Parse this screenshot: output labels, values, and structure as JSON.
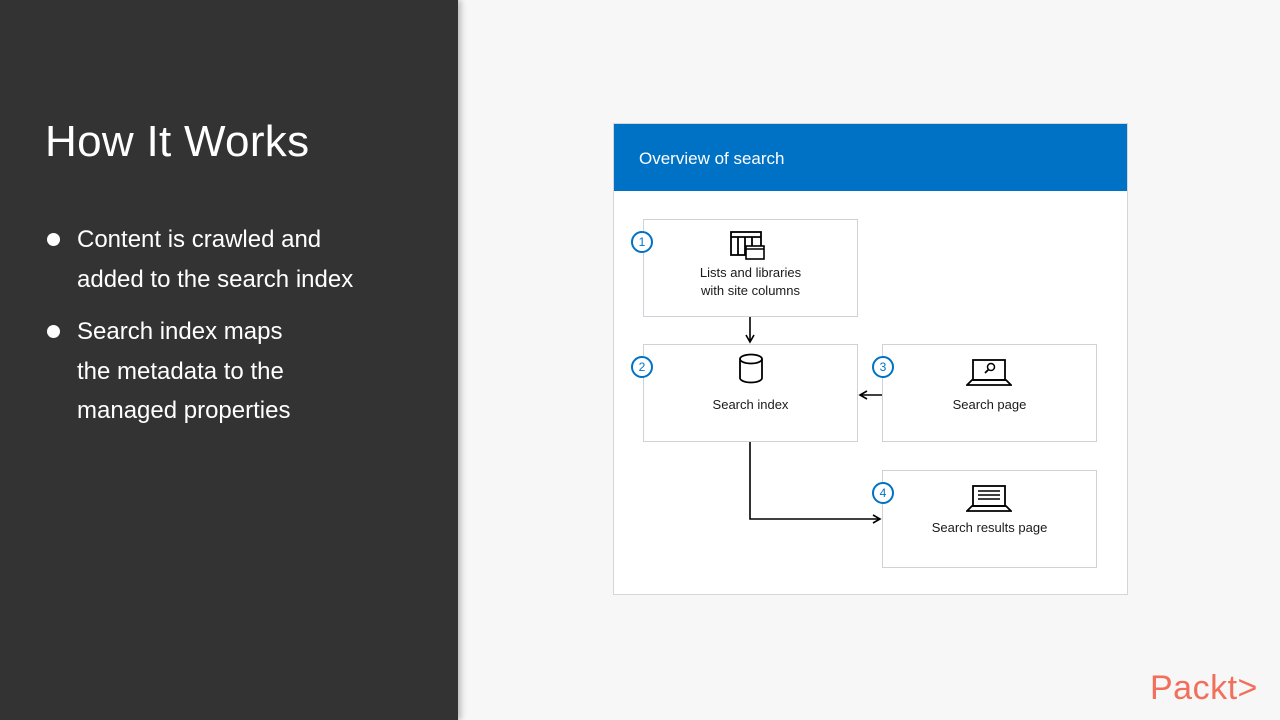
{
  "slide": {
    "title": "How It Works",
    "bullets": [
      {
        "lines": [
          "Content is crawled and",
          "added to the search index"
        ]
      },
      {
        "lines": [
          "Search index maps",
          "the metadata to the",
          "managed properties"
        ]
      }
    ]
  },
  "diagram": {
    "title": "Overview of search",
    "nodes": [
      {
        "step": "1",
        "lines": [
          "Lists and libraries",
          "with site columns"
        ],
        "icon": "list-library-icon"
      },
      {
        "step": "2",
        "lines": [
          "Search index"
        ],
        "icon": "database-icon"
      },
      {
        "step": "3",
        "lines": [
          "Search page"
        ],
        "icon": "laptop-search-icon"
      },
      {
        "step": "4",
        "lines": [
          "Search results page"
        ],
        "icon": "laptop-results-icon"
      }
    ]
  },
  "brand": {
    "name": "Packt>"
  },
  "colors": {
    "accent": "#0072c6",
    "panel": "#333333",
    "brand": "#f26f5c"
  }
}
